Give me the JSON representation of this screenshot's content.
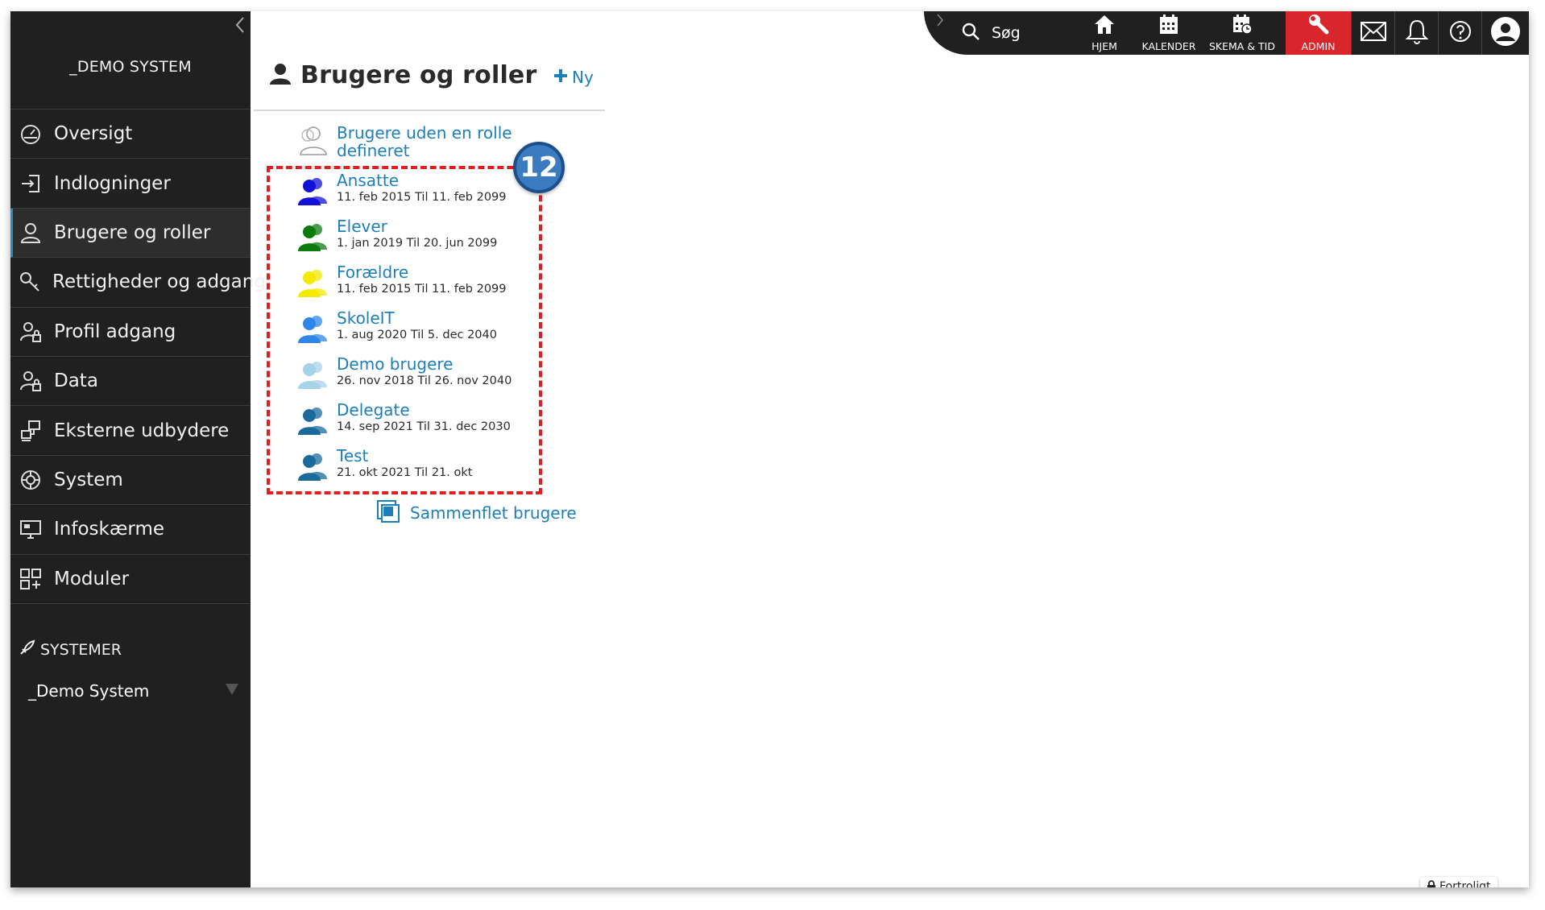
{
  "sidebar": {
    "system_title": "_DEMO SYSTEM",
    "items": [
      {
        "label": "Oversigt",
        "icon": "dashboard-icon"
      },
      {
        "label": "Indlogninger",
        "icon": "login-icon"
      },
      {
        "label": "Brugere og roller",
        "icon": "user-icon",
        "active": true
      },
      {
        "label": "Rettigheder og adgang",
        "icon": "key-icon"
      },
      {
        "label": "Profil adgang",
        "icon": "profile-lock-icon"
      },
      {
        "label": "Data",
        "icon": "data-lock-icon"
      },
      {
        "label": "Eksterne udbydere",
        "icon": "external-providers-icon"
      },
      {
        "label": "System",
        "icon": "system-icon"
      },
      {
        "label": "Infoskærme",
        "icon": "monitor-icon"
      },
      {
        "label": "Moduler",
        "icon": "modules-icon"
      }
    ],
    "systemer_label": "SYSTEMER",
    "selected_system": "_Demo System"
  },
  "topbar": {
    "search_label": "Søg",
    "buttons": [
      {
        "label": "HJEM",
        "icon": "home-icon"
      },
      {
        "label": "KALENDER",
        "icon": "calendar-icon"
      },
      {
        "label": "SKEMA & TID",
        "icon": "schedule-icon"
      },
      {
        "label": "ADMIN",
        "icon": "wrench-icon"
      }
    ],
    "admin_color": "#d8262c"
  },
  "content": {
    "title": "Brugere og roller",
    "new_label": "Ny",
    "no_role_label": "Brugere uden en rolle defineret",
    "roles": [
      {
        "name": "Ansatte",
        "dates": "11. feb 2015 Til 11. feb 2099",
        "color": "#1010d8"
      },
      {
        "name": "Elever",
        "dates": "1. jan 2019 Til 20. jun 2099",
        "color": "#0d7a0d"
      },
      {
        "name": "Forældre",
        "dates": "11. feb 2015 Til 11. feb 2099",
        "color": "#f4ea00"
      },
      {
        "name": "SkoleIT",
        "dates": "1. aug 2020 Til 5. dec 2040",
        "color": "#2f86e8"
      },
      {
        "name": "Demo brugere",
        "dates": "26. nov 2018 Til 26. nov 2040",
        "color": "#a6d2ea"
      },
      {
        "name": "Delegate",
        "dates": "14. sep 2021 Til 31. dec 2030",
        "color": "#1a6b9c"
      },
      {
        "name": "Test",
        "dates": "21. okt 2021 Til 21. okt",
        "color": "#1a6b9c"
      }
    ],
    "badge_number": "12",
    "merge_label": "Sammenflet brugere",
    "link_color": "#1d7fb8"
  },
  "footer": {
    "confidential_label": "Fortroligt"
  }
}
